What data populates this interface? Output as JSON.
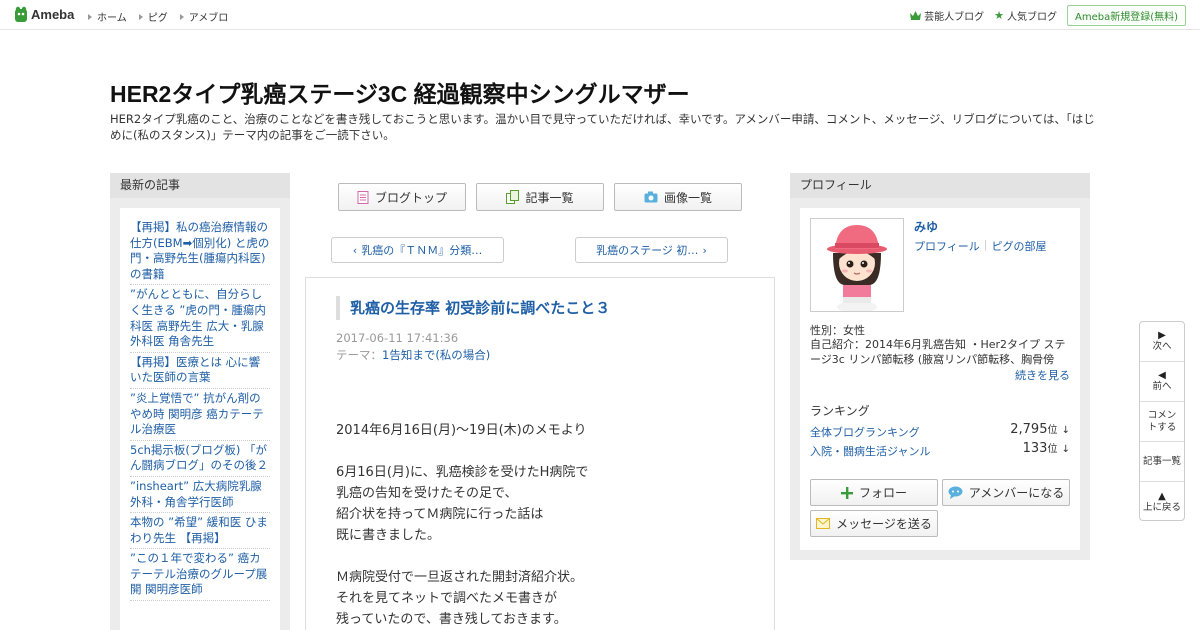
{
  "topbar": {
    "logo": "Ameba",
    "nav": [
      "ホーム",
      "ピグ",
      "アメブロ"
    ],
    "right_links": [
      "芸能人ブログ",
      "人気ブログ"
    ],
    "signup": "Ameba新規登録(無料)"
  },
  "header": {
    "title": "HER2タイプ乳癌ステージ3C 経過観察中シングルマザー",
    "description": "HER2タイプ乳癌のこと、治療のことなどを書き残しておこうと思います。温かい目で見守っていただければ、幸いです。アメンバー申請、コメント、メッセージ、リブログについては、「はじめに(私のスタンス)」テーマ内の記事をご一読下さい。"
  },
  "left": {
    "heading": "最新の記事",
    "items": [
      "【再掲】私の癌治療情報の仕方(EBM➡個別化) と虎の門・高野先生(腫瘍内科医)の書籍",
      "”がんとともに、自分らしく生きる ”虎の門・腫瘍内科医 高野先生 広大・乳腺外科医 角舎先生",
      "【再掲】医療とは 心に響いた医師の言葉",
      "”炎上覚悟で” 抗がん剤のやめ時 関明彦 癌カテーテル治療医",
      "5ch掲示板(ブログ板) 「がん闘病ブログ」のその後２",
      "”insheart” 広大病院乳腺外科・角舎学行医師",
      "本物の ”希望” 緩和医 ひまわり先生 【再掲】",
      "”この１年で変わる” 癌カテーテル治療のグループ展開 関明彦医師"
    ]
  },
  "center": {
    "tabs": [
      "ブログトップ",
      "記事一覧",
      "画像一覧"
    ],
    "prev": "乳癌の『ＴＮＭ』分類…",
    "next": "乳癌のステージ 初…",
    "article": {
      "title": "乳癌の生存率 初受診前に調べたこと３",
      "date": "2017-06-11 17:41:36",
      "theme_label": "テーマ：",
      "theme": "1告知まで(私の場合)",
      "body": [
        "2014年6月16日(月)～19日(木)のメモより",
        "",
        "6月16日(月)に、乳癌検診を受けたH病院で",
        "乳癌の告知を受けたその足で、",
        "紹介状を持ってＭ病院に行った話は",
        "既に書きました。",
        "",
        "Ｍ病院受付で一旦返された開封済紹介状。",
        "それを見てネットで調べたメモ書きが",
        "残っていたので、書き残しておきます。"
      ]
    }
  },
  "right": {
    "heading": "プロフィール",
    "name": "みゆ",
    "links": [
      "プロフィール",
      "ピグの部屋"
    ],
    "gender": "性別：女性",
    "intro": "自己紹介：2014年6月乳癌告知 ・Her2タイプ ステージ3c リンパ節転移 (腋窩リンパ節転移、胸骨傍リ...",
    "more": "続きを見る",
    "ranking_head": "ランキング",
    "ranking": [
      {
        "label": "全体ブログランキング",
        "value": "2,795",
        "unit": "位",
        "arrow": "↓"
      },
      {
        "label": "入院・闘病生活ジャンル",
        "value": "133",
        "unit": "位",
        "arrow": "↓"
      }
    ],
    "buttons": {
      "follow": "フォロー",
      "amember": "アメンバーになる",
      "message": "メッセージを送る"
    }
  },
  "sidenav": [
    {
      "glyph": "▶",
      "label": "次へ"
    },
    {
      "glyph": "◀",
      "label": "前へ"
    },
    {
      "glyph": "",
      "label": "コメントする"
    },
    {
      "glyph": "",
      "label": "記事一覧"
    },
    {
      "glyph": "▲",
      "label": "上に戻る"
    }
  ],
  "colors": {
    "link": "#1f5fa6",
    "brand_green": "#3a9b3a",
    "sidebar_bg": "#ececec"
  }
}
